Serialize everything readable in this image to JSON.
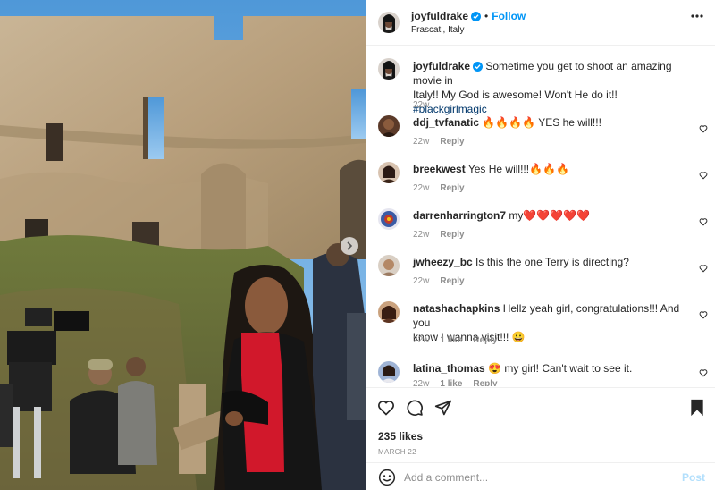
{
  "post": {
    "author": "joyfuldrake",
    "location": "Frascati, Italy",
    "follow_label": "Follow",
    "dot": "•",
    "caption": {
      "author": "joyfuldrake",
      "text_line1": "Sometime you get to shoot an amazing movie in",
      "text_line2": "Italy!! My God is awesome! Won't He do it!!",
      "hashtag": "#blackgirlmagic",
      "age": "22w"
    },
    "comments": [
      {
        "user": "ddj_tvfanatic",
        "text": "🔥🔥🔥🔥 YES he will!!!",
        "age": "22w",
        "reply": "Reply"
      },
      {
        "user": "breekwest",
        "text": "Yes He will!!!🔥🔥🔥",
        "age": "22w",
        "reply": "Reply"
      },
      {
        "user": "darrenharrington7",
        "text": "my❤️❤️❤️❤️❤️",
        "age": "22w",
        "reply": "Reply"
      },
      {
        "user": "jwheezy_bc",
        "text": "Is this the one Terry is directing?",
        "age": "22w",
        "reply": "Reply"
      },
      {
        "user": "natashachapkins",
        "text_line1": "Hellz yeah girl, congratulations!!! And you",
        "text_line2": "know I wanna visit!!! 😀",
        "age": "22w",
        "likes": "1 like",
        "reply": "Reply"
      },
      {
        "user": "latina_thomas",
        "text": "😍 my girl! Can't wait to see it.",
        "age": "22w",
        "likes": "1 like",
        "reply": "Reply"
      }
    ],
    "likes": "235 likes",
    "date": "MARCH 22",
    "comment_placeholder": "Add a comment...",
    "post_label": "Post"
  },
  "colors": {
    "accent": "#0095f6",
    "post_disabled": "#b2dffc",
    "muted": "#8e8e8e",
    "hashtag": "#00376b"
  },
  "icons": [
    "verified-badge-icon",
    "more-options-icon",
    "heart-icon",
    "comment-icon",
    "share-icon",
    "save-icon",
    "emoji-icon",
    "chevron-right-icon"
  ]
}
